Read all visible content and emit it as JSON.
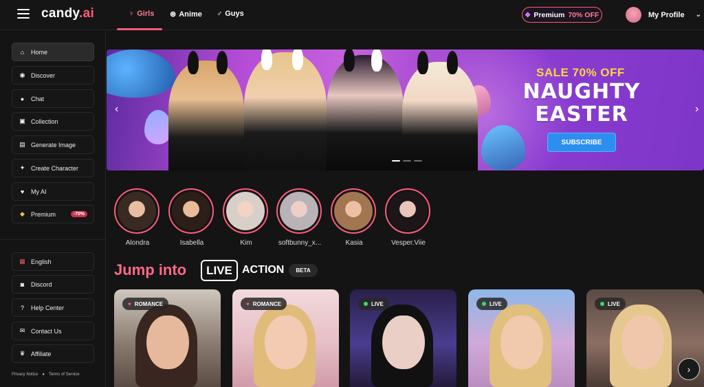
{
  "header": {
    "logo_main": "candy",
    "logo_ai": ".ai",
    "tabs": [
      {
        "label": "Girls",
        "icon": "female-icon"
      },
      {
        "label": "Anime",
        "icon": "anime-icon"
      },
      {
        "label": "Guys",
        "icon": "male-icon"
      }
    ],
    "premium_label": "Premium",
    "premium_off": "70% OFF",
    "profile_label": "My Profile"
  },
  "sidebar": {
    "items": [
      {
        "label": "Home",
        "icon": "home-icon"
      },
      {
        "label": "Discover",
        "icon": "compass-icon"
      },
      {
        "label": "Chat",
        "icon": "chat-icon"
      },
      {
        "label": "Collection",
        "icon": "collection-icon"
      },
      {
        "label": "Generate Image",
        "icon": "image-icon"
      },
      {
        "label": "Create Character",
        "icon": "magic-wand-icon"
      },
      {
        "label": "My AI",
        "icon": "heart-icon"
      },
      {
        "label": "Premium",
        "icon": "diamond-icon",
        "badge": "-70%"
      }
    ],
    "bottom_items": [
      {
        "label": "English",
        "icon": "flag-icon"
      },
      {
        "label": "Discord",
        "icon": "discord-icon"
      },
      {
        "label": "Help Center",
        "icon": "help-icon"
      },
      {
        "label": "Contact Us",
        "icon": "contact-icon"
      },
      {
        "label": "Affiliate",
        "icon": "trophy-icon"
      }
    ],
    "privacy": "Privacy Notice",
    "terms": "Terms of Service"
  },
  "banner": {
    "sale": "SALE 70% OFF",
    "line1": "NAUGHTY",
    "line2": "EASTER",
    "cta": "SUBSCRIBE"
  },
  "stories": [
    {
      "name": "Alondra"
    },
    {
      "name": "Isabella"
    },
    {
      "name": "Kim"
    },
    {
      "name": "softbunny_x..."
    },
    {
      "name": "Kasia"
    },
    {
      "name": "Vesper.Viie"
    }
  ],
  "live_section": {
    "jump": "Jump into",
    "live": "LIVE",
    "action": "ACTION",
    "beta": "BETA"
  },
  "cards": [
    {
      "tag": "ROMANCE"
    },
    {
      "tag": "ROMANCE"
    },
    {
      "tag": "LIVE"
    },
    {
      "tag": "LIVE"
    },
    {
      "tag": "LIVE"
    }
  ],
  "colors": {
    "accent": "#ff5c7a",
    "live_dot": "#3ddc5b",
    "cta": "#2c8ff0",
    "sale": "#ffd640"
  }
}
